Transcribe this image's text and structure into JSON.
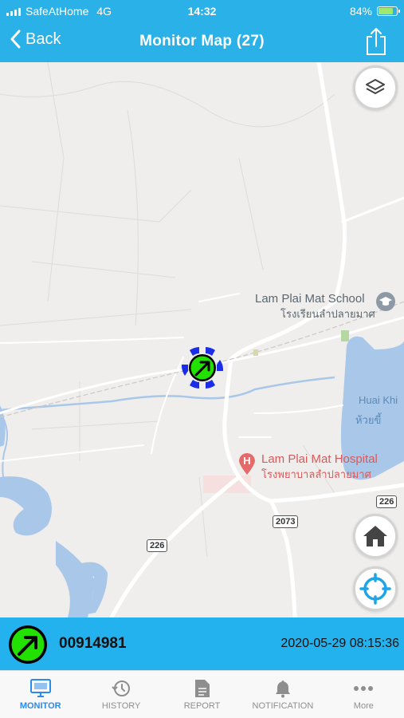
{
  "status_bar": {
    "carrier": "SafeAtHome",
    "network": "4G",
    "time": "14:32",
    "battery": "84%",
    "battery_level": 0.84
  },
  "nav": {
    "back_label": "Back",
    "title": "Monitor Map (27)"
  },
  "map": {
    "pois": {
      "school_en": "Lam Plai Mat School",
      "school_th": "โรงเรียนลำปลายมาศ",
      "hospital_en": "Lam Plai Mat Hospital",
      "hospital_th": "โรงพยาบาลลำปลายมาศ",
      "hospital_marker": "H"
    },
    "water": {
      "name_en": "Huai Khi",
      "name_th": "ห้วยขี้"
    },
    "road_shields": [
      "226",
      "2073",
      "226"
    ]
  },
  "vehicle": {
    "id": "00914981",
    "timestamp": "2020-05-29 08:15:36",
    "status_color": "#22e000"
  },
  "tabs": [
    {
      "label": "MONITOR",
      "icon": "monitor-icon",
      "active": true
    },
    {
      "label": "HISTORY",
      "icon": "history-icon",
      "active": false
    },
    {
      "label": "REPORT",
      "icon": "report-icon",
      "active": false
    },
    {
      "label": "NOTIFICATION",
      "icon": "bell-icon",
      "active": false
    },
    {
      "label": "More",
      "icon": "more-icon",
      "active": false
    }
  ],
  "colors": {
    "accent": "#2ab1e8",
    "info_bar": "#24b2ee",
    "tab_active": "#2a8be8",
    "map_bg": "#efeeec",
    "water": "#a9c7e8"
  }
}
